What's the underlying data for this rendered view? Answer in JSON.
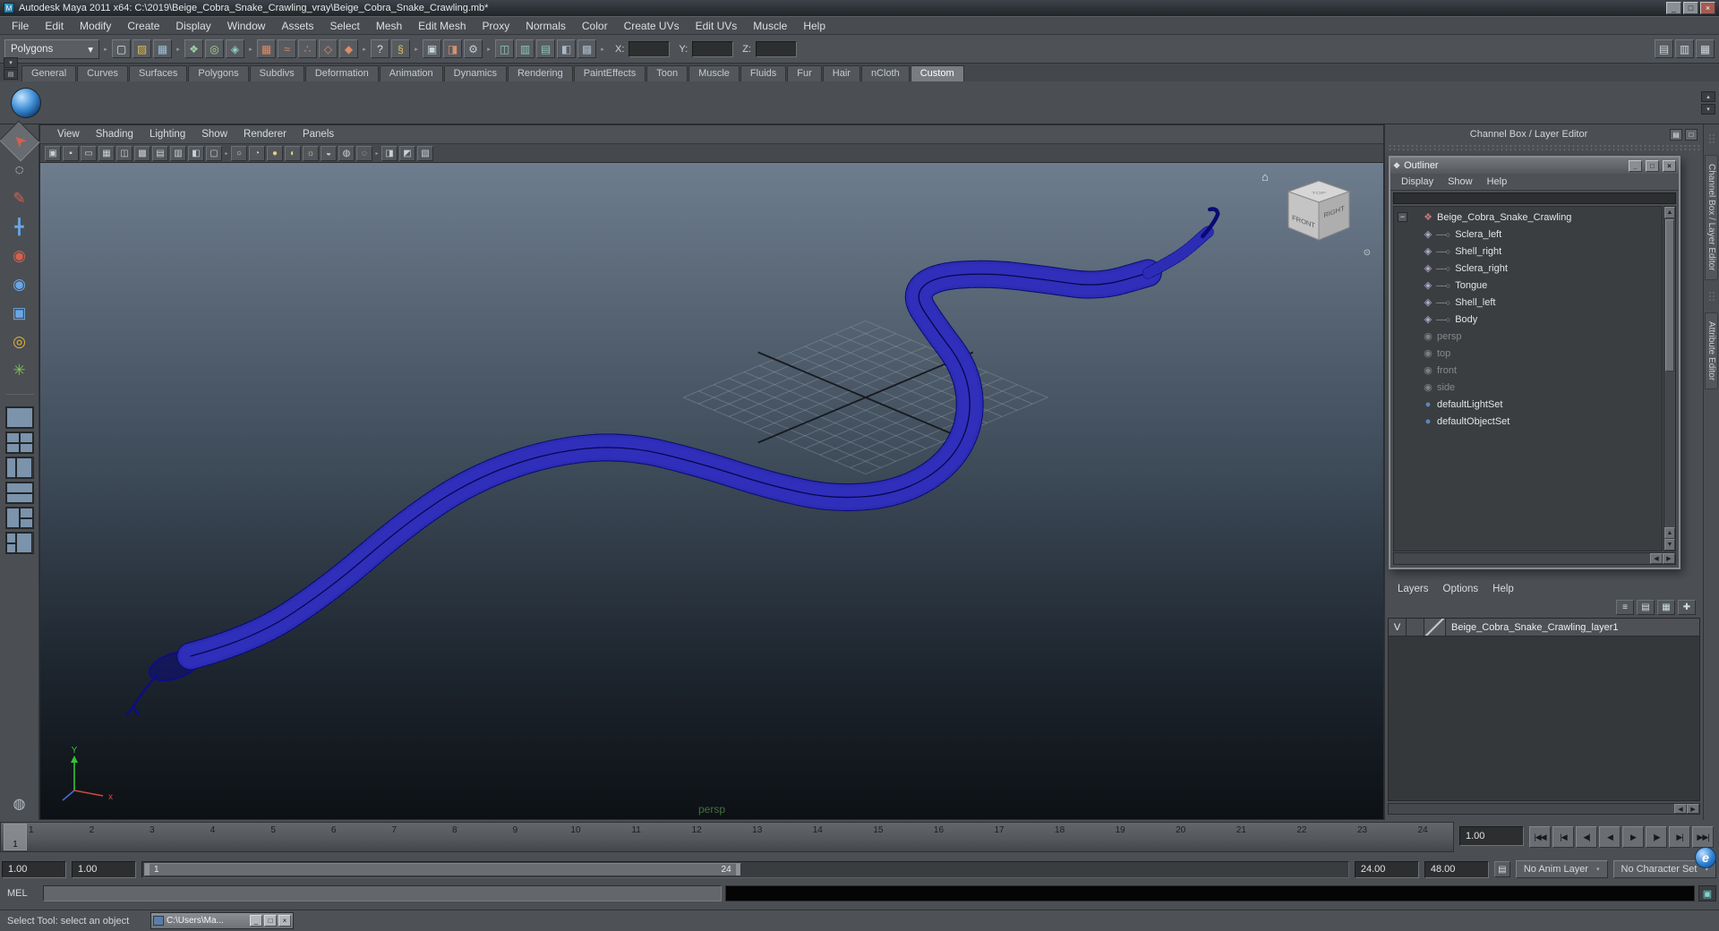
{
  "titlebar": {
    "title": "Autodesk Maya 2011 x64: C:\\2019\\Beige_Cobra_Snake_Crawling_vray\\Beige_Cobra_Snake_Crawling.mb*",
    "app_initial": "M",
    "minimize_glyph": "_",
    "maximize_glyph": "□",
    "close_glyph": "×"
  },
  "menubar": {
    "items": [
      "File",
      "Edit",
      "Modify",
      "Create",
      "Display",
      "Window",
      "Assets",
      "Select",
      "Mesh",
      "Edit Mesh",
      "Proxy",
      "Normals",
      "Color",
      "Create UVs",
      "Edit UVs",
      "Muscle",
      "Help"
    ]
  },
  "statusline": {
    "mode_selector": "Polygons",
    "dropdown_arrow": "▾",
    "file_icons": [
      {
        "name": "new-scene-icon",
        "glyph": "▢",
        "color": "#dbe3ea"
      },
      {
        "name": "open-scene-icon",
        "glyph": "▨",
        "color": "#d8b85a"
      },
      {
        "name": "save-scene-icon",
        "glyph": "▦",
        "color": "#9fc0d8"
      }
    ],
    "select_mode_icons": [
      {
        "name": "select-hierarchy-icon",
        "glyph": "❖",
        "color": "#9fd0a8"
      },
      {
        "name": "select-object-icon",
        "glyph": "◎",
        "color": "#a8d89a"
      },
      {
        "name": "select-component-icon",
        "glyph": "◈",
        "color": "#8fd0c8"
      }
    ],
    "snap_icons": [
      {
        "name": "snap-grid-icon",
        "glyph": "▦",
        "color": "#e08a66"
      },
      {
        "name": "snap-curve-icon",
        "glyph": "≈",
        "color": "#e08a66"
      },
      {
        "name": "snap-point-icon",
        "glyph": "∴",
        "color": "#e08a66"
      },
      {
        "name": "snap-view-icon",
        "glyph": "◇",
        "color": "#e08a66"
      },
      {
        "name": "snap-surface-icon",
        "glyph": "◆",
        "color": "#e08a66"
      }
    ],
    "history_icons": [
      {
        "name": "input-connections-icon",
        "glyph": "?",
        "color": "#dcdee0"
      },
      {
        "name": "construction-history-icon",
        "glyph": "§",
        "color": "#e0c060"
      }
    ],
    "render_icons": [
      {
        "name": "render-current-frame-icon",
        "glyph": "▣",
        "color": "#c8d4dc"
      },
      {
        "name": "ipr-render-icon",
        "glyph": "◨",
        "color": "#d89070"
      },
      {
        "name": "render-settings-icon",
        "glyph": "⚙",
        "color": "#c0ccd4"
      }
    ],
    "extra_icons": [
      {
        "name": "vray-vfb-icon",
        "glyph": "◫",
        "color": "#8fc8b8"
      },
      {
        "name": "vray-render-icon",
        "glyph": "▥",
        "color": "#8fc8b8"
      },
      {
        "name": "vray-options-icon",
        "glyph": "▤",
        "color": "#8fc8b8"
      },
      {
        "name": "hypershade-icon",
        "glyph": "◧",
        "color": "#a8b8c8"
      },
      {
        "name": "uv-editor-icon",
        "glyph": "▩",
        "color": "#a8b8c8"
      }
    ],
    "x_label": "X:",
    "y_label": "Y:",
    "z_label": "Z:",
    "x_value": "",
    "y_value": "",
    "z_value": "",
    "sidebar_icons": [
      {
        "name": "toggle-attribute-editor-icon",
        "glyph": "▤",
        "color": "#cfd6dd"
      },
      {
        "name": "toggle-tool-settings-icon",
        "glyph": "▥",
        "color": "#cfd6dd"
      },
      {
        "name": "toggle-channel-box-icon",
        "glyph": "▦",
        "color": "#cfd6dd"
      }
    ]
  },
  "shelf": {
    "tabs": [
      {
        "label": "General"
      },
      {
        "label": "Curves"
      },
      {
        "label": "Surfaces"
      },
      {
        "label": "Polygons"
      },
      {
        "label": "Subdivs"
      },
      {
        "label": "Deformation"
      },
      {
        "label": "Animation"
      },
      {
        "label": "Dynamics"
      },
      {
        "label": "Rendering"
      },
      {
        "label": "PaintEffects"
      },
      {
        "label": "Toon"
      },
      {
        "label": "Muscle"
      },
      {
        "label": "Fluids"
      },
      {
        "label": "Fur"
      },
      {
        "label": "Hair"
      },
      {
        "label": "nCloth"
      },
      {
        "label": "Custom",
        "active": true
      }
    ],
    "corner_icons": [
      {
        "name": "shelf-tab-menu-icon",
        "glyph": "▾"
      },
      {
        "name": "shelf-menu-icon",
        "glyph": "▤"
      }
    ],
    "right_icons": [
      {
        "name": "shelf-scroll-up-icon",
        "glyph": "▴"
      },
      {
        "name": "shelf-scroll-down-icon",
        "glyph": "▾"
      }
    ]
  },
  "toolbox": {
    "tools": [
      {
        "name": "select-tool-button",
        "glyph": "➤",
        "color": "#d6604d",
        "active": true,
        "rot": -135
      },
      {
        "name": "lasso-tool-button",
        "glyph": "◌",
        "color": "#dcdee0"
      },
      {
        "name": "paint-select-tool-button",
        "glyph": "✎",
        "color": "#d6604d"
      },
      {
        "name": "move-tool-button",
        "glyph": "╋",
        "color": "#6aa7e8"
      },
      {
        "name": "rotate-tool-button",
        "glyph": "◉",
        "color": "#d6604d"
      },
      {
        "name": "scale-tool-button",
        "glyph": "◉",
        "color": "#6aa7e8"
      },
      {
        "name": "universal-manipulator-button",
        "glyph": "▣",
        "color": "#6aa7e8"
      },
      {
        "name": "soft-modification-button",
        "glyph": "◎",
        "color": "#e0b23d"
      },
      {
        "name": "show-manipulator-button",
        "glyph": "✳",
        "color": "#7cc24f"
      }
    ],
    "layouts": [
      {
        "name": "layout-single-pane-button"
      },
      {
        "name": "layout-four-view-button"
      },
      {
        "name": "layout-outliner-persp-button"
      },
      {
        "name": "layout-two-stacked-button"
      },
      {
        "name": "layout-three-split-button"
      },
      {
        "name": "layout-hypershade-persp-button"
      }
    ],
    "bottom_icon": {
      "name": "toolbox-bottom-icon",
      "glyph": "◍"
    }
  },
  "viewport": {
    "menus": [
      "View",
      "Shading",
      "Lighting",
      "Show",
      "Renderer",
      "Panels"
    ],
    "camera_icons": [
      {
        "name": "select-camera-icon",
        "glyph": "▣"
      },
      {
        "name": "lock-camera-icon",
        "glyph": "▪"
      },
      {
        "name": "image-plane-icon",
        "glyph": "▭"
      },
      {
        "name": "grid-toggle-icon",
        "glyph": "▦"
      },
      {
        "name": "film-gate-icon",
        "glyph": "◫"
      },
      {
        "name": "resolution-gate-icon",
        "glyph": "▩"
      },
      {
        "name": "gate-mask-icon",
        "glyph": "▤"
      },
      {
        "name": "field-chart-icon",
        "glyph": "▥"
      },
      {
        "name": "safe-action-icon",
        "glyph": "◧"
      },
      {
        "name": "safe-title-icon",
        "glyph": "▢"
      }
    ],
    "shading_icons": [
      {
        "name": "wireframe-icon",
        "glyph": "○"
      },
      {
        "name": "points-shade-icon",
        "glyph": "◔"
      },
      {
        "name": "smooth-shade-icon",
        "glyph": "●",
        "color": "#e3cd7e"
      },
      {
        "name": "textured-icon",
        "glyph": "◐",
        "color": "#e3cd7e"
      },
      {
        "name": "use-all-lights-icon",
        "glyph": "☼",
        "color": "#e3cd7e"
      },
      {
        "name": "shadows-icon",
        "glyph": "◒"
      },
      {
        "name": "default-material-icon",
        "glyph": "◍"
      },
      {
        "name": "xray-icon",
        "glyph": "◌"
      }
    ],
    "extra_icons": [
      {
        "name": "isolate-select-icon",
        "glyph": "◨"
      },
      {
        "name": "field-guides-icon",
        "glyph": "◩"
      },
      {
        "name": "heads-up-display-icon",
        "glyph": "▧"
      }
    ],
    "camera_label": "persp",
    "viewcube": {
      "front_label": "FRONT",
      "right_label": "RIGHT",
      "top_label": "TOP",
      "home_glyph": "⌂",
      "orbit_glyph": "⊙"
    },
    "axis": {
      "y": "Y",
      "x": "x"
    }
  },
  "right_panel": {
    "header": "Channel Box / Layer Editor",
    "header_icons": [
      {
        "name": "panel-menu-icon",
        "glyph": "▤"
      },
      {
        "name": "panel-float-icon",
        "glyph": "□"
      }
    ]
  },
  "outliner": {
    "title": "Outliner",
    "window_buttons": {
      "minimize": "_",
      "maximize": "□",
      "close": "×"
    },
    "menus": [
      "Display",
      "Show",
      "Help"
    ],
    "icon_glyphs": {
      "transform": "❖",
      "mesh": "◈",
      "camera": "◉",
      "set": "●"
    },
    "icon_colors": {
      "transform": "#c07a72",
      "mesh": "#b3a8cc",
      "camera": "#94989c",
      "set": "#5d87c0"
    },
    "rows": [
      {
        "label": "Beige_Cobra_Snake_Crawling",
        "icon": "transform",
        "depth": 0,
        "expander": "−"
      },
      {
        "label": "Sclera_left",
        "icon": "mesh",
        "depth": 1
      },
      {
        "label": "Shell_right",
        "icon": "mesh",
        "depth": 1
      },
      {
        "label": "Sclera_right",
        "icon": "mesh",
        "depth": 1
      },
      {
        "label": "Tongue",
        "icon": "mesh",
        "depth": 1
      },
      {
        "label": "Shell_left",
        "icon": "mesh",
        "depth": 1
      },
      {
        "label": "Body",
        "icon": "mesh",
        "depth": 1
      },
      {
        "label": "persp",
        "icon": "camera",
        "depth": 0,
        "grayed": true
      },
      {
        "label": "top",
        "icon": "camera",
        "depth": 0,
        "grayed": true
      },
      {
        "label": "front",
        "icon": "camera",
        "depth": 0,
        "grayed": true
      },
      {
        "label": "side",
        "icon": "camera",
        "depth": 0,
        "grayed": true
      },
      {
        "label": "defaultLightSet",
        "icon": "set",
        "depth": 0
      },
      {
        "label": "defaultObjectSet",
        "icon": "set",
        "depth": 0
      }
    ]
  },
  "layer_editor": {
    "menus": [
      "Layers",
      "Options",
      "Help"
    ],
    "icons": [
      {
        "name": "sort-layers-icon",
        "glyph": "≡"
      },
      {
        "name": "layer-options-icon",
        "glyph": "▤"
      },
      {
        "name": "create-empty-layer-icon",
        "glyph": "▦"
      },
      {
        "name": "create-layer-from-selected-icon",
        "glyph": "✚"
      }
    ],
    "layers": [
      {
        "visible": "V",
        "name": "Beige_Cobra_Snake_Crawling_layer1"
      }
    ]
  },
  "side_tabs": [
    {
      "label": "Channel Box / Layer Editor"
    },
    {
      "label": "Attribute Editor"
    }
  ],
  "timeline": {
    "frames": [
      "1",
      "2",
      "3",
      "4",
      "5",
      "6",
      "7",
      "8",
      "9",
      "10",
      "11",
      "12",
      "13",
      "14",
      "15",
      "16",
      "17",
      "18",
      "19",
      "20",
      "21",
      "22",
      "23",
      "24"
    ],
    "current_frame": "1",
    "current_time": "1.00",
    "playback": [
      {
        "name": "go-to-start-button",
        "glyph": "|◀◀"
      },
      {
        "name": "step-back-frame-button",
        "glyph": "|◀"
      },
      {
        "name": "step-back-key-button",
        "glyph": "◀|"
      },
      {
        "name": "play-backwards-button",
        "glyph": "◀"
      },
      {
        "name": "play-forwards-button",
        "glyph": "▶"
      },
      {
        "name": "step-forward-key-button",
        "glyph": "|▶"
      },
      {
        "name": "step-forward-frame-button",
        "glyph": "▶|"
      },
      {
        "name": "go-to-end-button",
        "glyph": "▶▶|"
      }
    ]
  },
  "range_slider": {
    "animation_start": "1.00",
    "playback_start": "1.00",
    "playback_start_label": "1",
    "playback_end_label": "24",
    "playback_end": "24.00",
    "animation_end": "48.00",
    "anim_layer": "No Anim Layer",
    "character_set": "No Character Set",
    "dropdown_arrow": "▾"
  },
  "command_line": {
    "label": "MEL"
  },
  "help_line": {
    "message": "Select Tool: select an object"
  },
  "taskbar_window": {
    "title": "C:\\Users\\Ma...",
    "buttons": [
      {
        "name": "mini-minimize-button",
        "glyph": "_"
      },
      {
        "name": "mini-restore-button",
        "glyph": "□"
      },
      {
        "name": "mini-close-button",
        "glyph": "×"
      }
    ]
  },
  "browser_badge": {
    "glyph": "e"
  },
  "colors": {
    "wireframe": "#0a0a74",
    "viewport_top": "#6e7d8e",
    "viewport_bottom": "#0d1115"
  }
}
